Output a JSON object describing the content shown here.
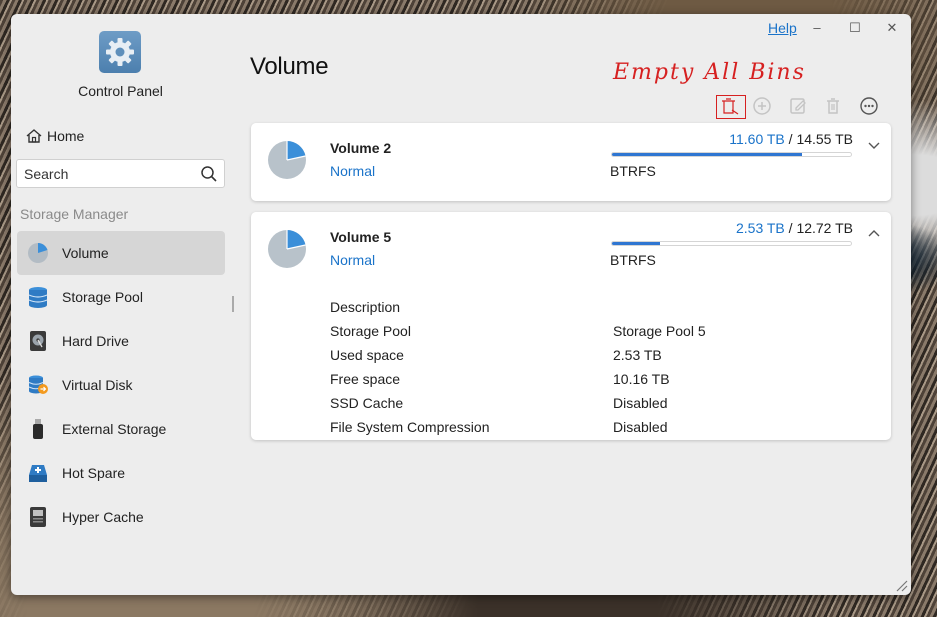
{
  "window": {
    "help_label": "Help",
    "minimize": "–",
    "maximize": "☐",
    "close": "✕"
  },
  "sidebar": {
    "app_title": "Control Panel",
    "home_label": "Home",
    "search_placeholder": "Search",
    "section_label": "Storage Manager",
    "items": [
      {
        "label": "Volume",
        "icon": "volume-pie-icon",
        "active": true
      },
      {
        "label": "Storage Pool",
        "icon": "storage-pool-icon"
      },
      {
        "label": "Hard Drive",
        "icon": "hard-drive-icon"
      },
      {
        "label": "Virtual Disk",
        "icon": "virtual-disk-icon"
      },
      {
        "label": "External Storage",
        "icon": "usb-drive-icon"
      },
      {
        "label": "Hot Spare",
        "icon": "hot-spare-icon"
      },
      {
        "label": "Hyper Cache",
        "icon": "hyper-cache-icon"
      }
    ]
  },
  "main": {
    "title": "Volume",
    "annotation": "Empty All Bins",
    "volumes": [
      {
        "name": "Volume 2",
        "status": "Normal",
        "filesystem": "BTRFS",
        "used": "11.60 TB",
        "separator": "/",
        "total": "14.55 TB",
        "usage_fraction": 0.797,
        "expanded": false
      },
      {
        "name": "Volume 5",
        "status": "Normal",
        "filesystem": "BTRFS",
        "used": "2.53 TB",
        "separator": "/",
        "total": "12.72 TB",
        "usage_fraction": 0.199,
        "expanded": true,
        "details": [
          {
            "label": "Description",
            "value": ""
          },
          {
            "label": "Storage Pool",
            "value": "Storage Pool 5"
          },
          {
            "label": "Used space",
            "value": "2.53 TB"
          },
          {
            "label": "Free space",
            "value": "10.16 TB"
          },
          {
            "label": "SSD Cache",
            "value": "Disabled"
          },
          {
            "label": "File System Compression",
            "value": "Disabled"
          }
        ]
      }
    ]
  },
  "colors": {
    "accent": "#1a73c9",
    "bar": "#2f76d2",
    "annotation": "#d62020"
  }
}
